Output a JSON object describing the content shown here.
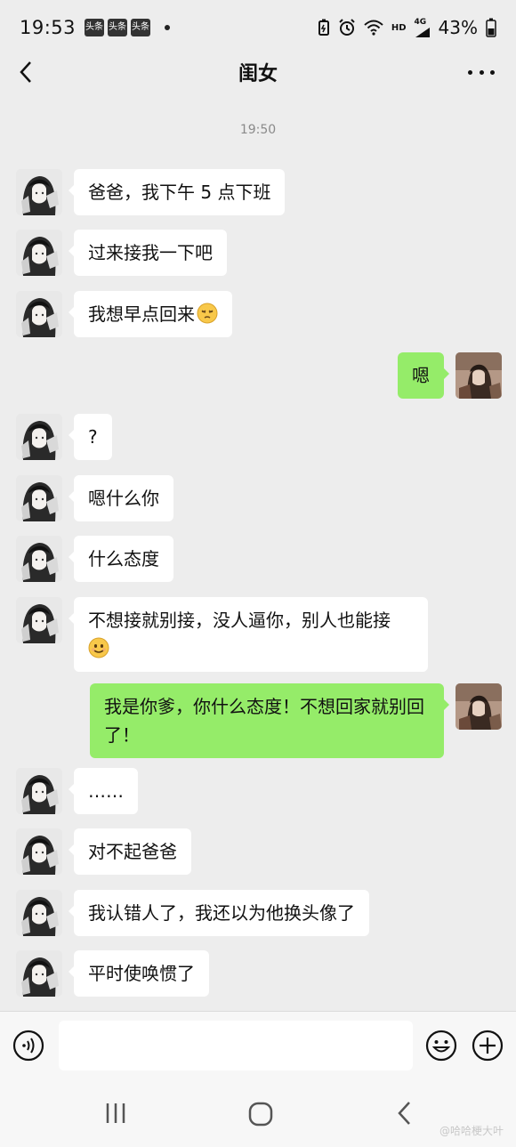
{
  "status_bar": {
    "time": "19:53",
    "app_badges": [
      "头条",
      "头条",
      "头条"
    ],
    "network_label": "HD",
    "signal_label": "4G",
    "battery": "43%"
  },
  "header": {
    "title": "闺女",
    "back_icon": "chevron-left-icon",
    "more_icon": "more-horizontal-icon"
  },
  "timestamp": "19:50",
  "messages": [
    {
      "side": "left",
      "text": "爸爸，我下午 5 点下班"
    },
    {
      "side": "left",
      "text": "过来接我一下吧"
    },
    {
      "side": "left",
      "text": "我想早点回来",
      "emoji": "sleepy-face"
    },
    {
      "side": "right",
      "text": "嗯"
    },
    {
      "side": "left",
      "text": "?"
    },
    {
      "side": "left",
      "text": "嗯什么你"
    },
    {
      "side": "left",
      "text": "什么态度"
    },
    {
      "side": "left",
      "text": "不想接就别接，没人逼你，别人也能接",
      "emoji": "smile-face"
    },
    {
      "side": "right",
      "text": "我是你爹，你什么态度！不想回家就别回了！"
    },
    {
      "side": "left",
      "text": "……"
    },
    {
      "side": "left",
      "text": "对不起爸爸"
    },
    {
      "side": "left",
      "text": "我认错人了，我还以为他换头像了"
    },
    {
      "side": "left",
      "text": "平时使唤惯了"
    }
  ],
  "input_bar": {
    "voice_icon": "voice-icon",
    "emoji_icon": "emoji-icon",
    "plus_icon": "plus-icon"
  },
  "watermark": "@哈哈梗大叶",
  "colors": {
    "background": "#ededed",
    "bubble_self": "#95ec69",
    "bubble_other": "#ffffff"
  }
}
